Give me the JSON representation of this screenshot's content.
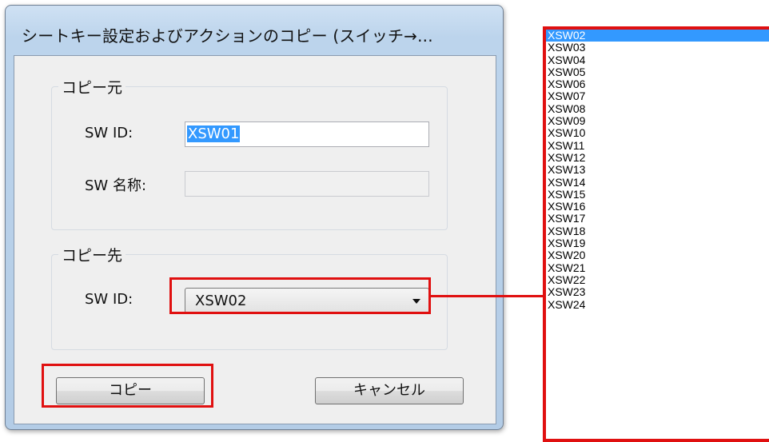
{
  "dialog": {
    "title": "シートキー設定およびアクションのコピー (スイッチ→..."
  },
  "source_group": {
    "label": "コピー元",
    "sw_id_label": "SW ID:",
    "sw_id_value": "XSW01",
    "sw_name_label": "SW 名称:",
    "sw_name_value": ""
  },
  "dest_group": {
    "label": "コピー先",
    "sw_id_label": "SW ID:",
    "sw_id_selected": "XSW02"
  },
  "buttons": {
    "copy": "コピー",
    "cancel": "キャンセル"
  },
  "dropdown_list": {
    "selected": "XSW02",
    "items": [
      "XSW02",
      "XSW03",
      "XSW04",
      "XSW05",
      "XSW06",
      "XSW07",
      "XSW08",
      "XSW09",
      "XSW10",
      "XSW11",
      "XSW12",
      "XSW13",
      "XSW14",
      "XSW15",
      "XSW16",
      "XSW17",
      "XSW18",
      "XSW19",
      "XSW20",
      "XSW21",
      "XSW22",
      "XSW23",
      "XSW24"
    ]
  },
  "colors": {
    "highlight_box": "#e01010",
    "selection": "#3399ff"
  }
}
